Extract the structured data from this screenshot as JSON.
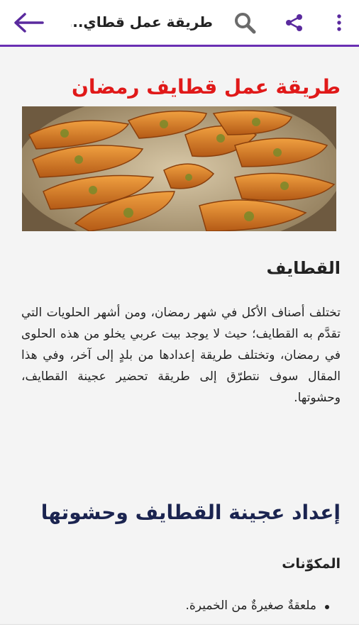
{
  "app_bar": {
    "title": "طريقة عمل قطاي...",
    "back_icon": "arrow-left-icon",
    "search_icon": "search-icon",
    "share_icon": "share-icon",
    "more_icon": "more-vertical-icon",
    "accent_color": "#6a2fb3"
  },
  "article": {
    "title": "طريقة عمل قطايف رمضان",
    "title_color": "#e01919",
    "image_alt_icon": "qatayef-photo",
    "section1_heading": "القطايف",
    "paragraph": "تختلف أصناف الأكل في شهر رمضان، ومن أشهر الحلويات التي تقدَّم به القطايف؛ حيث لا يوجد بيت عربي يخلو من هذه الحلوى في رمضان، وتختلف طريقة إعدادها من بلدٍ إلى آخر، وفي هذا المقال سوف نتطرّق إلى طريقة تحضير عجينة القطايف، وحشوتها.",
    "section2_heading": "إعداد عجينة القطايف وحشوتها",
    "ingredients_heading": "المكوّنات",
    "ingredients": [
      "ملعقةٌ صغيرةٌ من الخميرة."
    ]
  }
}
